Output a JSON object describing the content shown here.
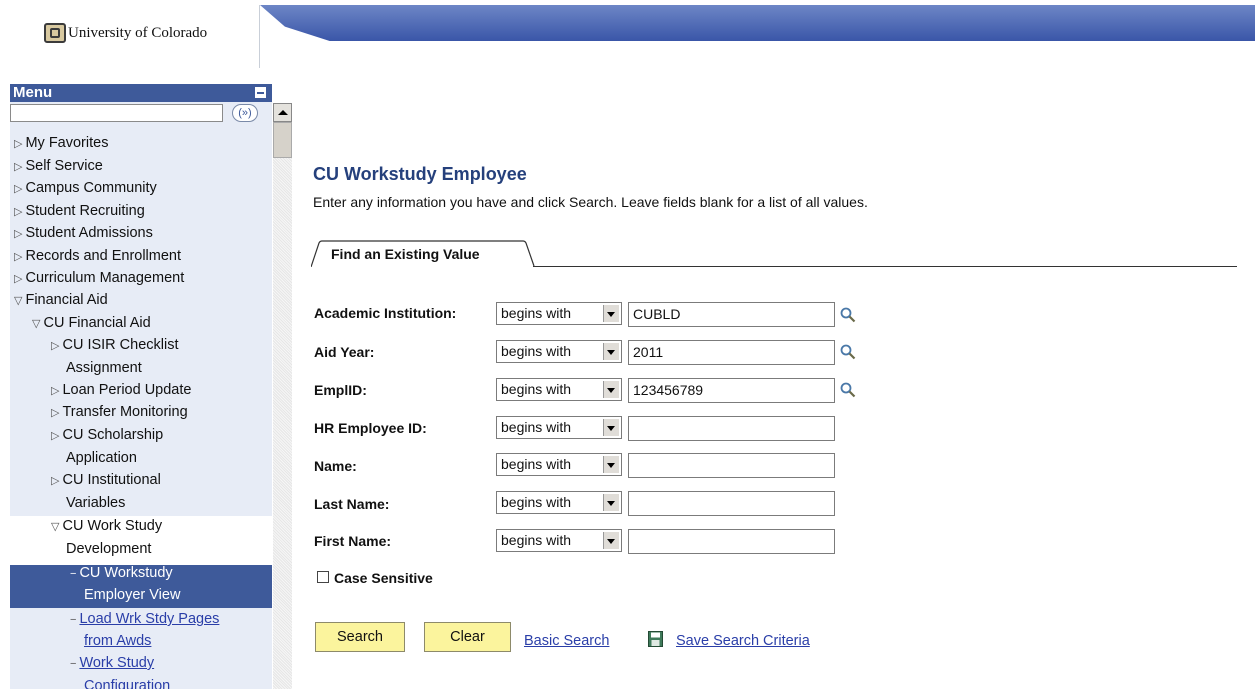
{
  "header": {
    "logo_text": "University of Colorado"
  },
  "menu": {
    "title": "Menu",
    "search_go": "(»)",
    "items": [
      {
        "label": "My Favorites"
      },
      {
        "label": "Self Service"
      },
      {
        "label": "Campus Community"
      },
      {
        "label": "Student Recruiting"
      },
      {
        "label": "Student Admissions"
      },
      {
        "label": "Records and Enrollment"
      },
      {
        "label": "Curriculum Management"
      },
      {
        "label": "Financial Aid"
      },
      {
        "label": "CU Financial Aid"
      },
      {
        "label_1": "CU ISIR Checklist",
        "label_2": "Assignment"
      },
      {
        "label": "Loan Period Update"
      },
      {
        "label": "Transfer Monitoring"
      },
      {
        "label_1": "CU Scholarship",
        "label_2": "Application"
      },
      {
        "label_1": "CU Institutional",
        "label_2": "Variables"
      },
      {
        "label_1": "CU Work Study",
        "label_2": "Development"
      },
      {
        "label_1": "CU Workstudy",
        "label_2": "Employer View"
      },
      {
        "label_1": "Load Wrk Stdy Pages",
        "label_2": "from Awds"
      },
      {
        "label_1": "Work Study",
        "label_2": "Configuration"
      }
    ]
  },
  "page": {
    "title": "CU Workstudy Employee",
    "instructions": "Enter any information you have and click Search. Leave fields blank for a list of all values.",
    "tab": "Find an Existing Value"
  },
  "fields": [
    {
      "label": "Academic Institution:",
      "operator": "begins with",
      "value": "CUBLD"
    },
    {
      "label": "Aid Year:",
      "operator": "begins with",
      "value": "2011"
    },
    {
      "label": "EmplID:",
      "operator": "begins with",
      "value": "123456789"
    },
    {
      "label": "HR Employee ID:",
      "operator": "begins with",
      "value": ""
    },
    {
      "label": "Name:",
      "operator": "begins with",
      "value": ""
    },
    {
      "label": "Last Name:",
      "operator": "begins with",
      "value": ""
    },
    {
      "label": "First Name:",
      "operator": "begins with",
      "value": ""
    }
  ],
  "case_sensitive": {
    "label": "Case Sensitive",
    "checked": false
  },
  "actions": {
    "search": "Search",
    "clear": "Clear",
    "basic_search": "Basic Search",
    "save_criteria": "Save Search Criteria"
  },
  "icons": {
    "lookup": "magnifier-icon",
    "save": "floppy-disk-icon",
    "collapsed": "triangle-right-icon",
    "expanded": "triangle-down-icon"
  },
  "colors": {
    "menu_header": "#3e5a9a",
    "menu_bg": "#e7ecf6",
    "title": "#25407c",
    "button_bg": "#fbf49d",
    "link": "#2a3ea8"
  }
}
